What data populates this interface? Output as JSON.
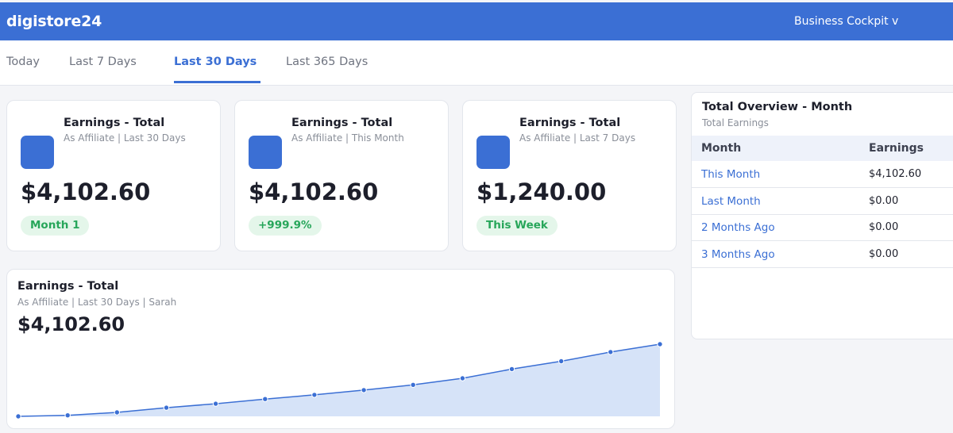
{
  "header": {
    "logo": "digistore24",
    "menu_label": "Business Cockpit  v"
  },
  "tabs": [
    {
      "label": "Today",
      "active": false
    },
    {
      "label": "Last 7 Days",
      "active": false
    },
    {
      "label": "Last 30 Days",
      "active": true
    },
    {
      "label": "Last 365 Days",
      "active": false
    }
  ],
  "kpis": [
    {
      "title": "Earnings - Total",
      "subtitle": "As Affiliate  |  Last 30 Days",
      "value": "$4,102.60",
      "badge": "Month 1"
    },
    {
      "title": "Earnings - Total",
      "subtitle": "As Affiliate  |  This Month",
      "value": "$4,102.60",
      "badge": "+999.9%"
    },
    {
      "title": "Earnings - Total",
      "subtitle": "As Affiliate  |  Last 7 Days",
      "value": "$1,240.00",
      "badge": "This Week"
    }
  ],
  "chart": {
    "title": "Earnings - Total",
    "subtitle": "As Affiliate  |  Last 30 Days  |  Sarah",
    "value": "$4,102.60"
  },
  "chart_data": {
    "type": "area",
    "title": "Earnings - Total",
    "points": 14,
    "values": [
      0,
      40,
      150,
      330,
      480,
      660,
      820,
      1000,
      1200,
      1450,
      1800,
      2100,
      2450,
      2750
    ]
  },
  "overview": {
    "title": "Total Overview - Month",
    "subtitle": "Total Earnings",
    "col_month": "Month",
    "col_earnings": "Earnings",
    "rows": [
      {
        "month": "This Month",
        "earnings": "$4,102.60"
      },
      {
        "month": "Last Month",
        "earnings": "$0.00"
      },
      {
        "month": "2 Months Ago",
        "earnings": "$0.00"
      },
      {
        "month": "3 Months Ago",
        "earnings": "$0.00"
      }
    ]
  },
  "colors": {
    "brand": "#3b6fd4",
    "badge_bg": "#e4f6ea",
    "badge_text": "#27a65a",
    "area_fill": "#d6e3f8"
  }
}
